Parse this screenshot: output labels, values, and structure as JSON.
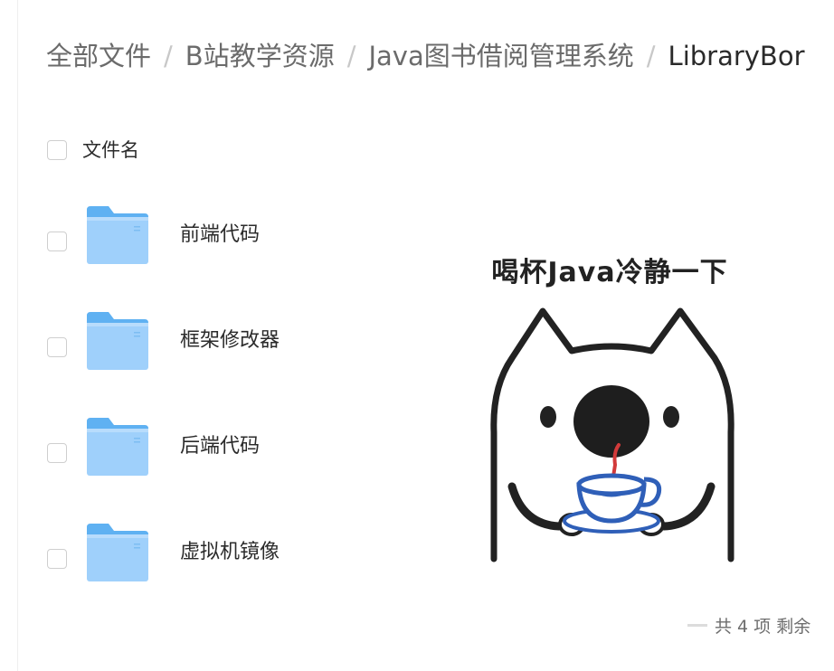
{
  "breadcrumb": {
    "items": [
      {
        "label": "全部文件"
      },
      {
        "label": "B站教学资源"
      },
      {
        "label": "Java图书借阅管理系统"
      },
      {
        "label": "LibraryBor"
      }
    ],
    "separator": "/"
  },
  "file_list": {
    "header_label": "文件名",
    "rows": [
      {
        "name": "前端代码",
        "icon": "folder-icon"
      },
      {
        "name": "框架修改器",
        "icon": "folder-icon"
      },
      {
        "name": "后端代码",
        "icon": "folder-icon"
      },
      {
        "name": "虚拟机镜像",
        "icon": "folder-icon"
      }
    ]
  },
  "sticker": {
    "caption": "喝杯Java冷静一下",
    "icon": "cat-drinking-coffee-sticker"
  },
  "footer": {
    "summary": "共 4 项 剩余"
  },
  "colors": {
    "folder_light": "#9fd0fb",
    "folder_dark": "#5fb1f2",
    "cup_blue": "#2f5fb8",
    "text_primary": "#2b2b2b",
    "text_secondary": "#6b6b6b"
  }
}
